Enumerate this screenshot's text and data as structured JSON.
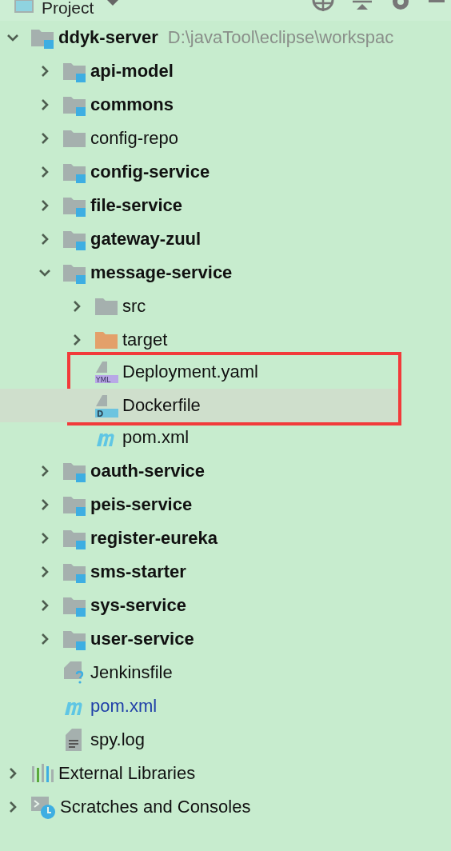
{
  "panel": {
    "title": "Project"
  },
  "tree": [
    {
      "label": "ddyk-server",
      "kind": "module",
      "path": "D:\\javaTool\\eclipse\\workspac",
      "expanded": true,
      "selected": false,
      "children": [
        {
          "label": "api-model",
          "kind": "module",
          "expanded": false,
          "selected": false
        },
        {
          "label": "commons",
          "kind": "module",
          "expanded": false,
          "selected": false
        },
        {
          "label": "config-repo",
          "kind": "folder",
          "expanded": false,
          "selected": false
        },
        {
          "label": "config-service",
          "kind": "module",
          "expanded": false,
          "selected": false
        },
        {
          "label": "file-service",
          "kind": "module",
          "expanded": false,
          "selected": false
        },
        {
          "label": "gateway-zuul",
          "kind": "module",
          "expanded": false,
          "selected": false
        },
        {
          "label": "message-service",
          "kind": "module",
          "expanded": true,
          "selected": false,
          "children": [
            {
              "label": "src",
              "kind": "folder",
              "expanded": false,
              "selected": false
            },
            {
              "label": "target",
              "kind": "excluded",
              "expanded": false,
              "selected": false
            },
            {
              "label": "Deployment.yaml",
              "kind": "yaml",
              "badge": "YML",
              "boxed": true,
              "selected": false
            },
            {
              "label": "Dockerfile",
              "kind": "docker",
              "badge": "D",
              "boxed": true,
              "selected": true
            },
            {
              "label": "pom.xml",
              "kind": "maven",
              "selected": false
            }
          ]
        },
        {
          "label": "oauth-service",
          "kind": "module",
          "expanded": false,
          "selected": false
        },
        {
          "label": "peis-service",
          "kind": "module",
          "expanded": false,
          "selected": false
        },
        {
          "label": "register-eureka",
          "kind": "module",
          "expanded": false,
          "selected": false
        },
        {
          "label": "sms-starter",
          "kind": "module",
          "expanded": false,
          "selected": false
        },
        {
          "label": "sys-service",
          "kind": "module",
          "expanded": false,
          "selected": false
        },
        {
          "label": "user-service",
          "kind": "module",
          "expanded": false,
          "selected": false
        },
        {
          "label": "Jenkinsfile",
          "kind": "unknown",
          "selected": false
        },
        {
          "label": "pom.xml",
          "kind": "maven",
          "modified": true,
          "selected": false
        },
        {
          "label": "spy.log",
          "kind": "log",
          "selected": false
        }
      ]
    },
    {
      "label": "External Libraries",
      "kind": "libraries",
      "expanded": false,
      "selected": false
    },
    {
      "label": "Scratches and Consoles",
      "kind": "scratches",
      "expanded": false,
      "selected": false
    }
  ]
}
